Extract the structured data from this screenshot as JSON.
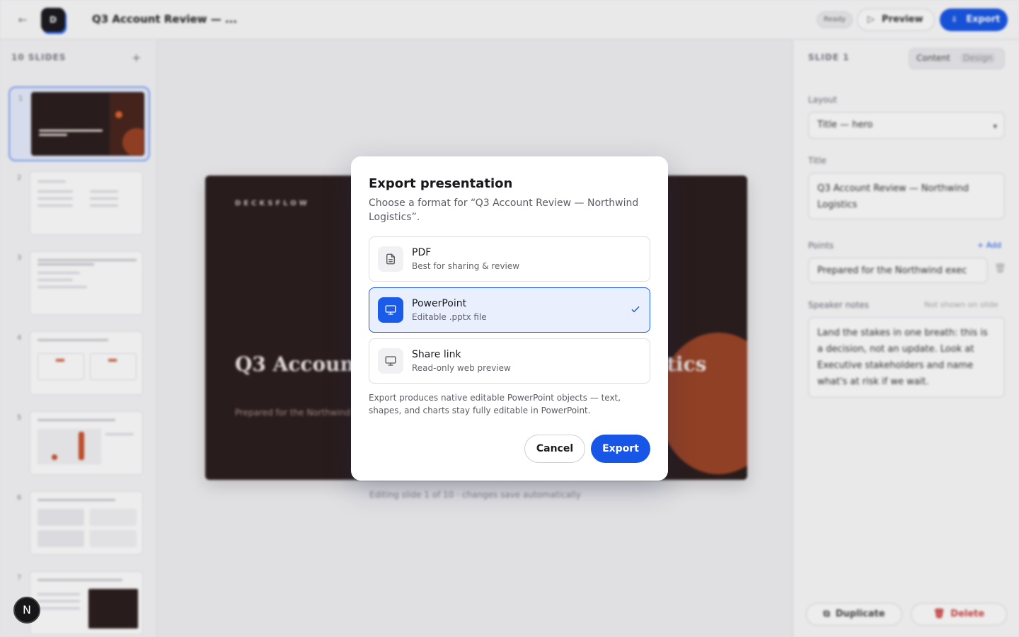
{
  "topbar": {
    "back_icon": "arrow-left-icon",
    "doc_title": "Q3 Account Review — ...",
    "saved_badge": "Ready",
    "preview_label": "Preview",
    "export_label": "Export"
  },
  "left_panel": {
    "header": "10 SLIDES",
    "add_icon": "plus-icon",
    "slide_numbers": [
      "1",
      "2",
      "3",
      "4",
      "5",
      "6",
      "7"
    ]
  },
  "canvas": {
    "brand": "DECKSFLOW",
    "title": "Q3 Account Review — Northwind Logistics",
    "subtitle": "Prepared for the Northwind executive team",
    "status": "Editing slide 1 of 10 · changes save automatically"
  },
  "right_panel": {
    "header": "SLIDE 1",
    "tabs": [
      "Content",
      "Design"
    ],
    "layout_label": "Layout",
    "layout_value": "Title — hero",
    "title_label": "Title",
    "title_value": "Q3 Account Review — Northwind Logistics",
    "points_label": "Points",
    "points_add": "+ Add",
    "points_value": "Prepared for the Northwind exec",
    "notes_label": "Speaker notes",
    "notes_hint": "Not shown on slide",
    "notes_value": "Land the stakes in one breath: this is a decision, not an update. Look at Executive stakeholders and name what's at risk if we wait.",
    "duplicate_label": "Duplicate",
    "delete_label": "Delete"
  },
  "modal": {
    "title": "Export presentation",
    "description": "Choose a format for “Q3 Account Review — Northwind Logistics”.",
    "options": [
      {
        "name": "PDF",
        "sub": "Best for sharing & review",
        "icon": "document-icon",
        "selected": false
      },
      {
        "name": "PowerPoint",
        "sub": "Editable .pptx file",
        "icon": "monitor-icon",
        "selected": true
      },
      {
        "name": "Share link",
        "sub": "Read-only web preview",
        "icon": "monitor-icon",
        "selected": false
      }
    ],
    "note": "Export produces native editable PowerPoint objects — text, shapes, and charts stay fully editable in PowerPoint.",
    "cancel_label": "Cancel",
    "export_label": "Export"
  },
  "badge": {
    "letter": "N"
  },
  "colors": {
    "accent": "#1756e6",
    "slide_bg": "#2b1d1d",
    "slide_accent": "#c2522a"
  }
}
